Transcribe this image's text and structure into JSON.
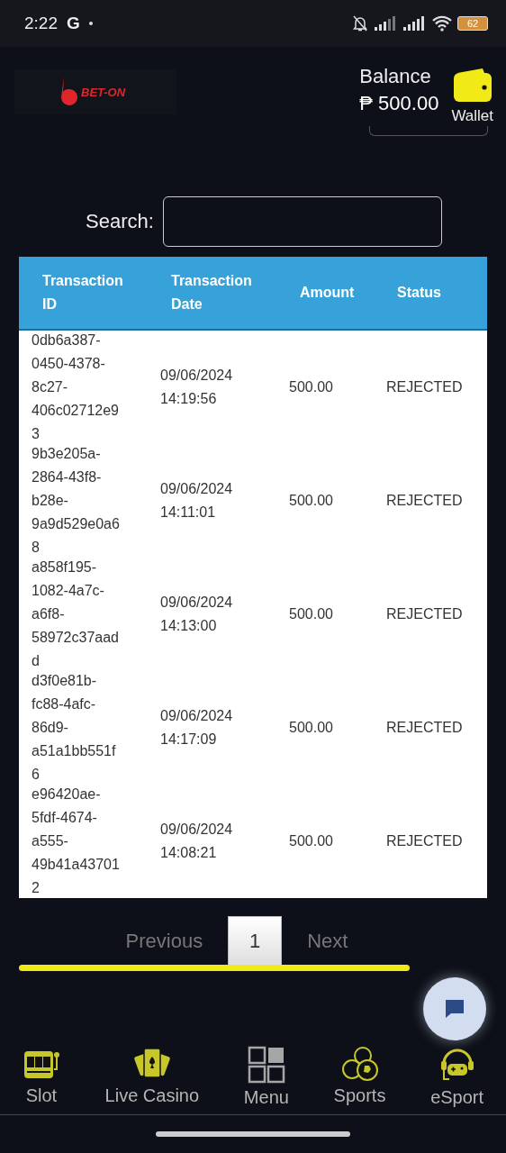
{
  "status_bar": {
    "time": "2:22",
    "carrier_letter": "G",
    "battery": "62"
  },
  "header": {
    "logo_text": "BET-ON",
    "balance_label": "Balance",
    "balance": "₱ 500.00",
    "wallet_label": "Wallet"
  },
  "search": {
    "label": "Search:"
  },
  "table": {
    "columns": [
      "Transaction ID",
      "Transaction Date",
      "Amount",
      "Status"
    ],
    "rows": [
      {
        "id": "0db6a387-0450-4378-8c27-406c02712e93",
        "date": "09/06/2024 14:19:56",
        "amount": "500.00",
        "status": "REJECTED"
      },
      {
        "id": "9b3e205a-2864-43f8-b28e-9a9d529e0a68",
        "date": "09/06/2024 14:11:01",
        "amount": "500.00",
        "status": "REJECTED"
      },
      {
        "id": "a858f195-1082-4a7c-a6f8-58972c37aadd",
        "date": "09/06/2024 14:13:00",
        "amount": "500.00",
        "status": "REJECTED"
      },
      {
        "id": "d3f0e81b-fc88-4afc-86d9-a51a1bb551f6",
        "date": "09/06/2024 14:17:09",
        "amount": "500.00",
        "status": "REJECTED"
      },
      {
        "id": "e96420ae-5fdf-4674-a555-49b41a437012",
        "date": "09/06/2024 14:08:21",
        "amount": "500.00",
        "status": "REJECTED"
      }
    ]
  },
  "pagination": {
    "previous": "Previous",
    "pages": [
      {
        "label": "1",
        "selected": true
      }
    ],
    "next": "Next"
  },
  "bottom_nav": [
    {
      "label": "Slot",
      "kind": "slot"
    },
    {
      "label": "Live Casino",
      "kind": "cards"
    },
    {
      "label": "Menu",
      "kind": "menu"
    },
    {
      "label": "Sports",
      "kind": "sports"
    },
    {
      "label": "eSport",
      "kind": "esport"
    }
  ]
}
